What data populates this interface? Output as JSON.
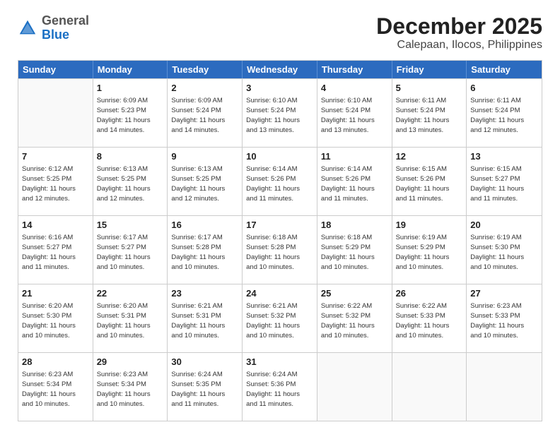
{
  "logo": {
    "general": "General",
    "blue": "Blue"
  },
  "title": "December 2025",
  "subtitle": "Calepaan, Ilocos, Philippines",
  "header_days": [
    "Sunday",
    "Monday",
    "Tuesday",
    "Wednesday",
    "Thursday",
    "Friday",
    "Saturday"
  ],
  "weeks": [
    [
      {
        "day": "",
        "info": ""
      },
      {
        "day": "1",
        "info": "Sunrise: 6:09 AM\nSunset: 5:23 PM\nDaylight: 11 hours\nand 14 minutes."
      },
      {
        "day": "2",
        "info": "Sunrise: 6:09 AM\nSunset: 5:24 PM\nDaylight: 11 hours\nand 14 minutes."
      },
      {
        "day": "3",
        "info": "Sunrise: 6:10 AM\nSunset: 5:24 PM\nDaylight: 11 hours\nand 13 minutes."
      },
      {
        "day": "4",
        "info": "Sunrise: 6:10 AM\nSunset: 5:24 PM\nDaylight: 11 hours\nand 13 minutes."
      },
      {
        "day": "5",
        "info": "Sunrise: 6:11 AM\nSunset: 5:24 PM\nDaylight: 11 hours\nand 13 minutes."
      },
      {
        "day": "6",
        "info": "Sunrise: 6:11 AM\nSunset: 5:24 PM\nDaylight: 11 hours\nand 12 minutes."
      }
    ],
    [
      {
        "day": "7",
        "info": "Sunrise: 6:12 AM\nSunset: 5:25 PM\nDaylight: 11 hours\nand 12 minutes."
      },
      {
        "day": "8",
        "info": "Sunrise: 6:13 AM\nSunset: 5:25 PM\nDaylight: 11 hours\nand 12 minutes."
      },
      {
        "day": "9",
        "info": "Sunrise: 6:13 AM\nSunset: 5:25 PM\nDaylight: 11 hours\nand 12 minutes."
      },
      {
        "day": "10",
        "info": "Sunrise: 6:14 AM\nSunset: 5:26 PM\nDaylight: 11 hours\nand 11 minutes."
      },
      {
        "day": "11",
        "info": "Sunrise: 6:14 AM\nSunset: 5:26 PM\nDaylight: 11 hours\nand 11 minutes."
      },
      {
        "day": "12",
        "info": "Sunrise: 6:15 AM\nSunset: 5:26 PM\nDaylight: 11 hours\nand 11 minutes."
      },
      {
        "day": "13",
        "info": "Sunrise: 6:15 AM\nSunset: 5:27 PM\nDaylight: 11 hours\nand 11 minutes."
      }
    ],
    [
      {
        "day": "14",
        "info": "Sunrise: 6:16 AM\nSunset: 5:27 PM\nDaylight: 11 hours\nand 11 minutes."
      },
      {
        "day": "15",
        "info": "Sunrise: 6:17 AM\nSunset: 5:27 PM\nDaylight: 11 hours\nand 10 minutes."
      },
      {
        "day": "16",
        "info": "Sunrise: 6:17 AM\nSunset: 5:28 PM\nDaylight: 11 hours\nand 10 minutes."
      },
      {
        "day": "17",
        "info": "Sunrise: 6:18 AM\nSunset: 5:28 PM\nDaylight: 11 hours\nand 10 minutes."
      },
      {
        "day": "18",
        "info": "Sunrise: 6:18 AM\nSunset: 5:29 PM\nDaylight: 11 hours\nand 10 minutes."
      },
      {
        "day": "19",
        "info": "Sunrise: 6:19 AM\nSunset: 5:29 PM\nDaylight: 11 hours\nand 10 minutes."
      },
      {
        "day": "20",
        "info": "Sunrise: 6:19 AM\nSunset: 5:30 PM\nDaylight: 11 hours\nand 10 minutes."
      }
    ],
    [
      {
        "day": "21",
        "info": "Sunrise: 6:20 AM\nSunset: 5:30 PM\nDaylight: 11 hours\nand 10 minutes."
      },
      {
        "day": "22",
        "info": "Sunrise: 6:20 AM\nSunset: 5:31 PM\nDaylight: 11 hours\nand 10 minutes."
      },
      {
        "day": "23",
        "info": "Sunrise: 6:21 AM\nSunset: 5:31 PM\nDaylight: 11 hours\nand 10 minutes."
      },
      {
        "day": "24",
        "info": "Sunrise: 6:21 AM\nSunset: 5:32 PM\nDaylight: 11 hours\nand 10 minutes."
      },
      {
        "day": "25",
        "info": "Sunrise: 6:22 AM\nSunset: 5:32 PM\nDaylight: 11 hours\nand 10 minutes."
      },
      {
        "day": "26",
        "info": "Sunrise: 6:22 AM\nSunset: 5:33 PM\nDaylight: 11 hours\nand 10 minutes."
      },
      {
        "day": "27",
        "info": "Sunrise: 6:23 AM\nSunset: 5:33 PM\nDaylight: 11 hours\nand 10 minutes."
      }
    ],
    [
      {
        "day": "28",
        "info": "Sunrise: 6:23 AM\nSunset: 5:34 PM\nDaylight: 11 hours\nand 10 minutes."
      },
      {
        "day": "29",
        "info": "Sunrise: 6:23 AM\nSunset: 5:34 PM\nDaylight: 11 hours\nand 10 minutes."
      },
      {
        "day": "30",
        "info": "Sunrise: 6:24 AM\nSunset: 5:35 PM\nDaylight: 11 hours\nand 11 minutes."
      },
      {
        "day": "31",
        "info": "Sunrise: 6:24 AM\nSunset: 5:36 PM\nDaylight: 11 hours\nand 11 minutes."
      },
      {
        "day": "",
        "info": ""
      },
      {
        "day": "",
        "info": ""
      },
      {
        "day": "",
        "info": ""
      }
    ]
  ]
}
